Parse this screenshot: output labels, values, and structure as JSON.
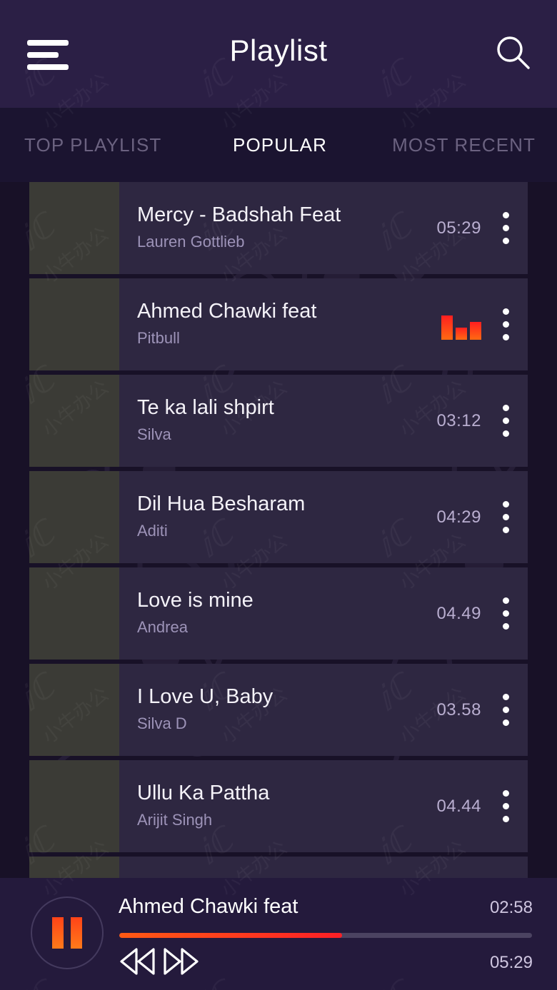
{
  "header": {
    "title": "Playlist",
    "menu_icon": "hamburger-menu-icon",
    "search_icon": "search-icon"
  },
  "tabs": [
    {
      "label": "TOP PLAYLIST",
      "active": false
    },
    {
      "label": "POPULAR",
      "active": true
    },
    {
      "label": "MOST RECENT",
      "active": false
    }
  ],
  "playlist": [
    {
      "title": "Mercy - Badshah Feat",
      "artist": "Lauren Gottlieb",
      "duration": "05:29",
      "playing": false
    },
    {
      "title": "Ahmed Chawki feat",
      "artist": "Pitbull",
      "duration": "",
      "playing": true
    },
    {
      "title": "Te ka lali shpirt",
      "artist": "Silva",
      "duration": "03:12",
      "playing": false
    },
    {
      "title": "Dil Hua Besharam",
      "artist": "Aditi",
      "duration": "04:29",
      "playing": false
    },
    {
      "title": "Love is mine",
      "artist": "Andrea",
      "duration": "04.49",
      "playing": false
    },
    {
      "title": " I Love U, Baby",
      "artist": "Silva D",
      "duration": "03.58",
      "playing": false
    },
    {
      "title": "Ullu Ka Pattha",
      "artist": "Arijit Singh",
      "duration": "04.44",
      "playing": false
    }
  ],
  "player": {
    "now_playing": "Ahmed Chawki feat",
    "current_time": "02:58",
    "total_time": "05:29",
    "progress_percent": 54,
    "state": "playing",
    "pause_icon": "pause-icon",
    "prev_icon": "rewind-icon",
    "next_icon": "fast-forward-icon"
  },
  "watermark": {
    "text": "小牛办公"
  },
  "colors": {
    "header_bg": "#2b1f45",
    "tabs_bg": "#1b1430",
    "page_bg": "#181127",
    "row_bg": "#2e2741",
    "thumb_bg": "#3b3b36",
    "accent_orange": "#ff5a14",
    "accent_red": "#fc1f26",
    "title_text": "#f4f2f8",
    "artist_text": "#9d93b8",
    "duration_text": "#b9aed0",
    "tab_inactive": "#6b6280",
    "player_bg": "#241a3c"
  }
}
